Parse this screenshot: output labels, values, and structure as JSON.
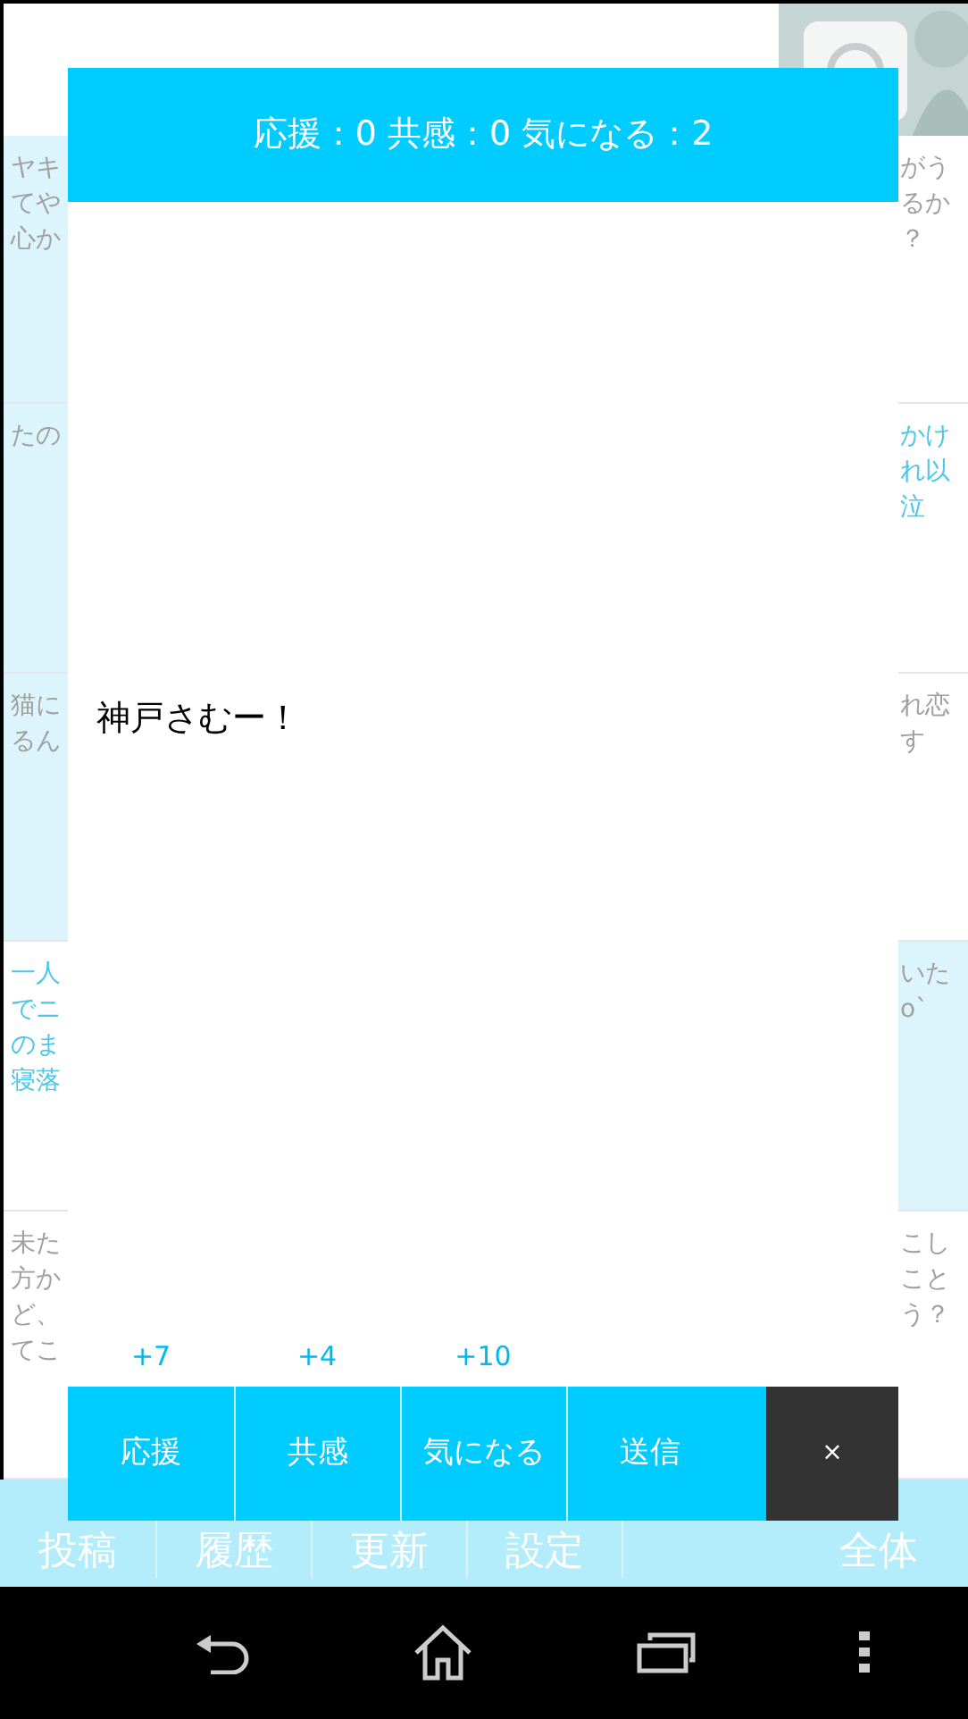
{
  "rows": [
    {
      "left": {
        "lines": [
          "ヤキ",
          "てや",
          "心か"
        ],
        "highlight": false,
        "shaded": true
      },
      "right": {
        "lines": [
          "がう",
          "るか",
          "？"
        ],
        "highlight": false,
        "shaded": false
      }
    },
    {
      "left": {
        "lines": [
          "たの"
        ],
        "highlight": false,
        "shaded": true
      },
      "right": {
        "lines": [
          "かけ",
          "れ以",
          "泣"
        ],
        "highlight": true,
        "shaded": false
      }
    },
    {
      "left": {
        "lines": [
          "猫に",
          "るん"
        ],
        "highlight": false,
        "shaded": true
      },
      "right": {
        "lines": [
          "れ恋",
          "す"
        ],
        "highlight": false,
        "shaded": false
      }
    },
    {
      "left": {
        "lines": [
          "一人",
          "でニ",
          "のま",
          "寝落"
        ],
        "highlight": true,
        "shaded": false
      },
      "right": {
        "lines": [
          "いた",
          "o`"
        ],
        "highlight": false,
        "shaded": true
      }
    },
    {
      "left": {
        "lines": [
          "未た",
          "方か",
          "ど、",
          "てこ"
        ],
        "highlight": false,
        "shaded": false
      },
      "right": {
        "lines": [
          "こし",
          "こと",
          "う？"
        ],
        "highlight": false,
        "shaded": false
      }
    }
  ],
  "tabs": [
    "投稿",
    "履歴",
    "更新",
    "設定",
    "全体"
  ],
  "modal": {
    "title": "応援：0 共感：0 気になる：2",
    "message": "神戸さむー！",
    "actions": [
      {
        "label": "応援",
        "count": "+7"
      },
      {
        "label": "共感",
        "count": "+4"
      },
      {
        "label": "気になる",
        "count": "+10"
      },
      {
        "label": "送信"
      }
    ],
    "close": "×"
  }
}
